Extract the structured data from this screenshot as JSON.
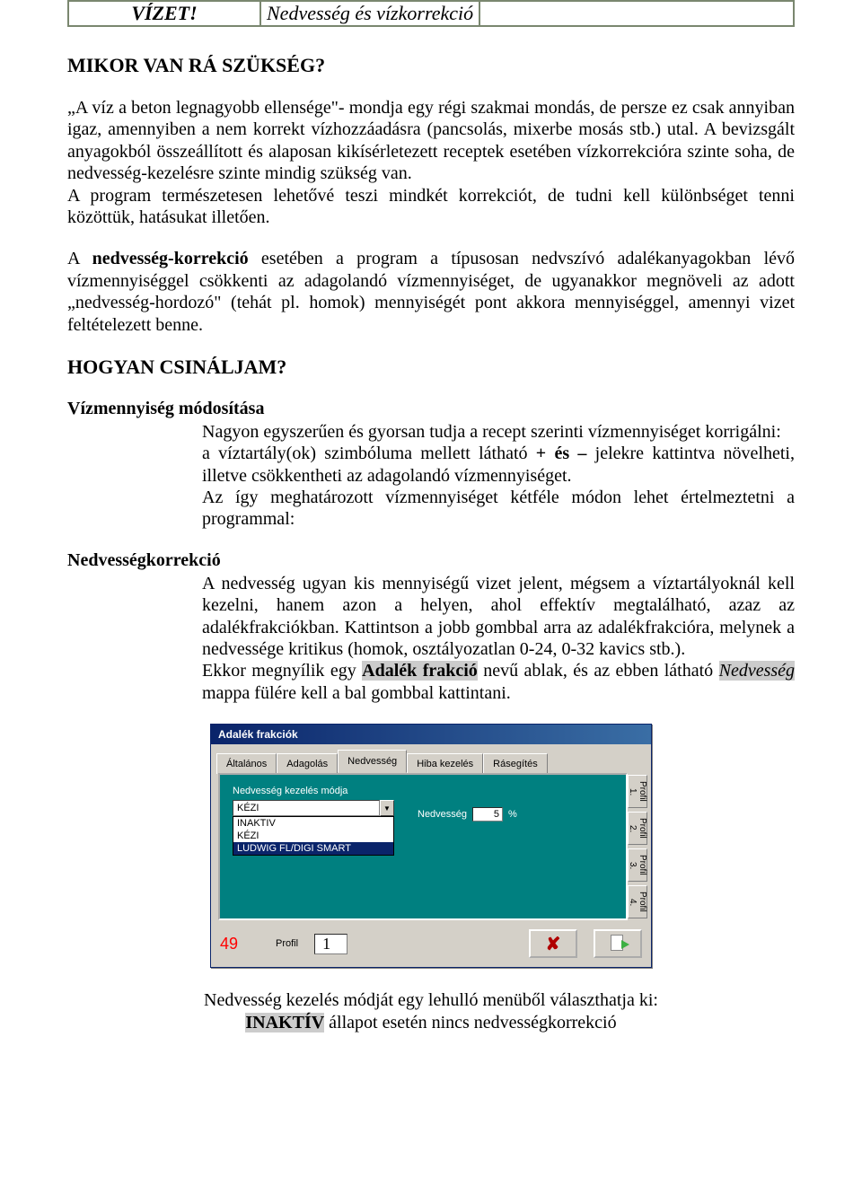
{
  "top_table": {
    "left": "VÍZET!",
    "right": "Nedvesség és vízkorrekció"
  },
  "h1": "MIKOR VAN RÁ SZÜKSÉG?",
  "p1": "„A víz a beton legnagyobb ellensége\"- mondja egy régi szakmai mondás, de persze ez csak annyiban igaz, amennyiben a nem korrekt vízhozzáadásra (pancsolás, mixerbe mosás stb.) utal. A bevizsgált anyagokból összeállított és alaposan kikísérletezett receptek esetében vízkorrekcióra szinte soha, de nedvesség-kezelésre szinte mindig szükség van.",
  "p1b": "A program természetesen lehetővé teszi mindkét korrekciót, de tudni kell különbséget tenni közöttük, hatásukat illetően.",
  "p2a": "A ",
  "p2b": "nedvesség-korrekció",
  "p2c": " esetében a program a típusosan nedvszívó adalékanyagokban lévő vízmennyiséggel csökkenti az adagolandó vízmennyiséget, de ugyanakkor megnöveli az adott „nedvesség-hordozó\" (tehát pl. homok) mennyiségét pont akkora mennyiséggel, amennyi vizet feltételezett benne.",
  "h2": "HOGYAN CSINÁLJAM?",
  "sec1_title": "Vízmennyiség módosítása",
  "sec1_l1": "Nagyon egyszerűen és gyorsan tudja a recept szerinti vízmennyiséget korrigálni:",
  "sec1_l2a": "a víztartály(ok) szimbóluma mellett látható ",
  "sec1_l2b": "+ és –",
  "sec1_l2c": " jelekre kattintva növelheti, illetve csökkentheti az adagolandó vízmennyiséget.",
  "sec1_l3": "Az így meghatározott vízmennyiséget kétféle módon lehet értelmeztetni a programmal:",
  "sec2_title": "Nedvességkorrekció",
  "sec2_l1": "A nedvesség ugyan kis mennyiségű vizet jelent, mégsem a víztartályoknál kell kezelni, hanem azon a helyen, ahol effektív megtalálható, azaz az adalékfrakciókban. Kattintson a jobb gombbal arra az adalékfrakcióra, melynek a nedvessége kritikus (homok, osztályozatlan 0-24, 0-32 kavics stb.).",
  "sec2_l2a": "Ekkor megnyílik egy ",
  "sec2_l2b": "Adalék frakció",
  "sec2_l2c": " nevű ablak, és az ebben látható ",
  "sec2_l2d": "Nedvesség",
  "sec2_l2e": " mappa fülére kell a bal gombbal kattintani.",
  "dialog": {
    "title": "Adalék frakciók",
    "tabs": [
      "Általános",
      "Adagolás",
      "Nedvesség",
      "Hiba kezelés",
      "Rásegítés"
    ],
    "group_label": "Nedvesség kezelés módja",
    "combo_value": "KÉZI",
    "options": [
      "INAKTIV",
      "KÉZI",
      "LUDWIG FL/DIGI SMART"
    ],
    "nedv_label": "Nedvesség",
    "nedv_value": "5",
    "nedv_unit": "%",
    "profiles": [
      "Profil 1.",
      "Profil 2.",
      "Profil 3.",
      "Profil 4."
    ],
    "bottom_number": "49",
    "profil_label": "Profil",
    "profil_value": "1"
  },
  "final1": "Nedvesség kezelés módját egy lehulló menüből választhatja ki:",
  "final2a": "INAKTÍV",
  "final2b": " állapot esetén nincs nedvességkorrekció"
}
